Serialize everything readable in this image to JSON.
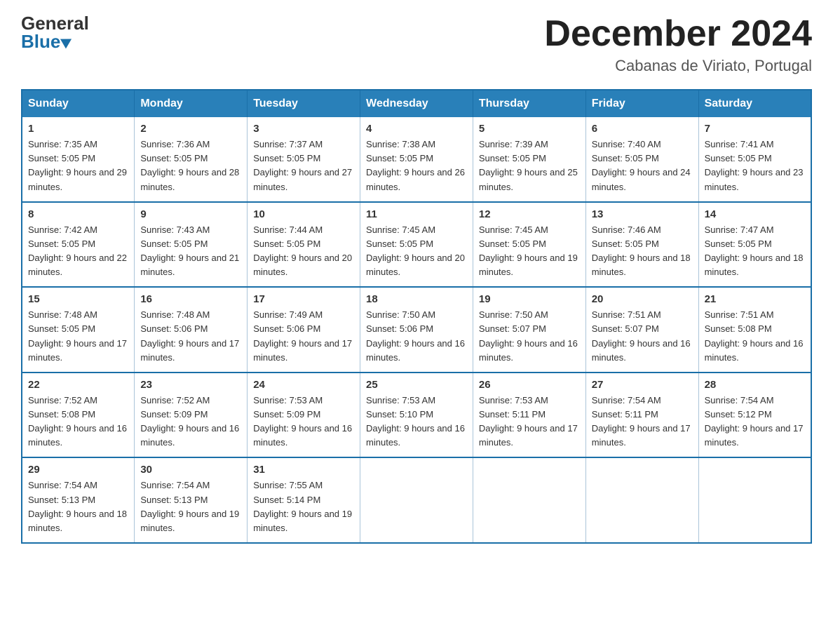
{
  "header": {
    "logo_general": "General",
    "logo_blue": "Blue",
    "month_title": "December 2024",
    "location": "Cabanas de Viriato, Portugal"
  },
  "calendar": {
    "days_of_week": [
      "Sunday",
      "Monday",
      "Tuesday",
      "Wednesday",
      "Thursday",
      "Friday",
      "Saturday"
    ],
    "weeks": [
      [
        {
          "day": "1",
          "sunrise": "7:35 AM",
          "sunset": "5:05 PM",
          "daylight": "9 hours and 29 minutes."
        },
        {
          "day": "2",
          "sunrise": "7:36 AM",
          "sunset": "5:05 PM",
          "daylight": "9 hours and 28 minutes."
        },
        {
          "day": "3",
          "sunrise": "7:37 AM",
          "sunset": "5:05 PM",
          "daylight": "9 hours and 27 minutes."
        },
        {
          "day": "4",
          "sunrise": "7:38 AM",
          "sunset": "5:05 PM",
          "daylight": "9 hours and 26 minutes."
        },
        {
          "day": "5",
          "sunrise": "7:39 AM",
          "sunset": "5:05 PM",
          "daylight": "9 hours and 25 minutes."
        },
        {
          "day": "6",
          "sunrise": "7:40 AM",
          "sunset": "5:05 PM",
          "daylight": "9 hours and 24 minutes."
        },
        {
          "day": "7",
          "sunrise": "7:41 AM",
          "sunset": "5:05 PM",
          "daylight": "9 hours and 23 minutes."
        }
      ],
      [
        {
          "day": "8",
          "sunrise": "7:42 AM",
          "sunset": "5:05 PM",
          "daylight": "9 hours and 22 minutes."
        },
        {
          "day": "9",
          "sunrise": "7:43 AM",
          "sunset": "5:05 PM",
          "daylight": "9 hours and 21 minutes."
        },
        {
          "day": "10",
          "sunrise": "7:44 AM",
          "sunset": "5:05 PM",
          "daylight": "9 hours and 20 minutes."
        },
        {
          "day": "11",
          "sunrise": "7:45 AM",
          "sunset": "5:05 PM",
          "daylight": "9 hours and 20 minutes."
        },
        {
          "day": "12",
          "sunrise": "7:45 AM",
          "sunset": "5:05 PM",
          "daylight": "9 hours and 19 minutes."
        },
        {
          "day": "13",
          "sunrise": "7:46 AM",
          "sunset": "5:05 PM",
          "daylight": "9 hours and 18 minutes."
        },
        {
          "day": "14",
          "sunrise": "7:47 AM",
          "sunset": "5:05 PM",
          "daylight": "9 hours and 18 minutes."
        }
      ],
      [
        {
          "day": "15",
          "sunrise": "7:48 AM",
          "sunset": "5:05 PM",
          "daylight": "9 hours and 17 minutes."
        },
        {
          "day": "16",
          "sunrise": "7:48 AM",
          "sunset": "5:06 PM",
          "daylight": "9 hours and 17 minutes."
        },
        {
          "day": "17",
          "sunrise": "7:49 AM",
          "sunset": "5:06 PM",
          "daylight": "9 hours and 17 minutes."
        },
        {
          "day": "18",
          "sunrise": "7:50 AM",
          "sunset": "5:06 PM",
          "daylight": "9 hours and 16 minutes."
        },
        {
          "day": "19",
          "sunrise": "7:50 AM",
          "sunset": "5:07 PM",
          "daylight": "9 hours and 16 minutes."
        },
        {
          "day": "20",
          "sunrise": "7:51 AM",
          "sunset": "5:07 PM",
          "daylight": "9 hours and 16 minutes."
        },
        {
          "day": "21",
          "sunrise": "7:51 AM",
          "sunset": "5:08 PM",
          "daylight": "9 hours and 16 minutes."
        }
      ],
      [
        {
          "day": "22",
          "sunrise": "7:52 AM",
          "sunset": "5:08 PM",
          "daylight": "9 hours and 16 minutes."
        },
        {
          "day": "23",
          "sunrise": "7:52 AM",
          "sunset": "5:09 PM",
          "daylight": "9 hours and 16 minutes."
        },
        {
          "day": "24",
          "sunrise": "7:53 AM",
          "sunset": "5:09 PM",
          "daylight": "9 hours and 16 minutes."
        },
        {
          "day": "25",
          "sunrise": "7:53 AM",
          "sunset": "5:10 PM",
          "daylight": "9 hours and 16 minutes."
        },
        {
          "day": "26",
          "sunrise": "7:53 AM",
          "sunset": "5:11 PM",
          "daylight": "9 hours and 17 minutes."
        },
        {
          "day": "27",
          "sunrise": "7:54 AM",
          "sunset": "5:11 PM",
          "daylight": "9 hours and 17 minutes."
        },
        {
          "day": "28",
          "sunrise": "7:54 AM",
          "sunset": "5:12 PM",
          "daylight": "9 hours and 17 minutes."
        }
      ],
      [
        {
          "day": "29",
          "sunrise": "7:54 AM",
          "sunset": "5:13 PM",
          "daylight": "9 hours and 18 minutes."
        },
        {
          "day": "30",
          "sunrise": "7:54 AM",
          "sunset": "5:13 PM",
          "daylight": "9 hours and 19 minutes."
        },
        {
          "day": "31",
          "sunrise": "7:55 AM",
          "sunset": "5:14 PM",
          "daylight": "9 hours and 19 minutes."
        },
        null,
        null,
        null,
        null
      ]
    ]
  }
}
